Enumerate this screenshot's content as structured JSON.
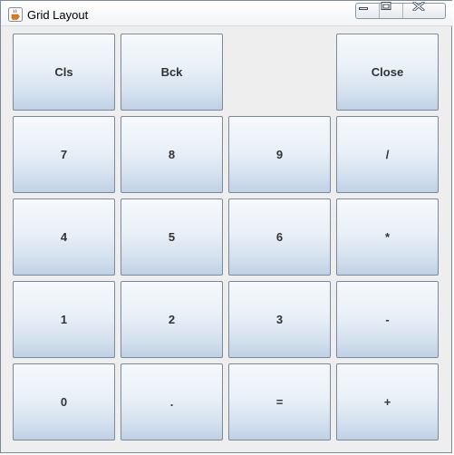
{
  "window": {
    "title": "Grid Layout",
    "icon": "java-cup-icon",
    "controls": [
      "minimize-icon",
      "maximize-icon",
      "close-icon"
    ]
  },
  "buttons": [
    [
      "Cls",
      "Bck",
      "",
      "Close"
    ],
    [
      "7",
      "8",
      "9",
      "/"
    ],
    [
      "4",
      "5",
      "6",
      "*"
    ],
    [
      "1",
      "2",
      "3",
      "-"
    ],
    [
      "0",
      ".",
      "=",
      "+"
    ]
  ],
  "colors": {
    "button_border": "#7a8a99",
    "button_top": "#f6f9fc",
    "button_bottom": "#bfd1e6",
    "panel_background": "#eeeeee",
    "label": "#333333"
  }
}
